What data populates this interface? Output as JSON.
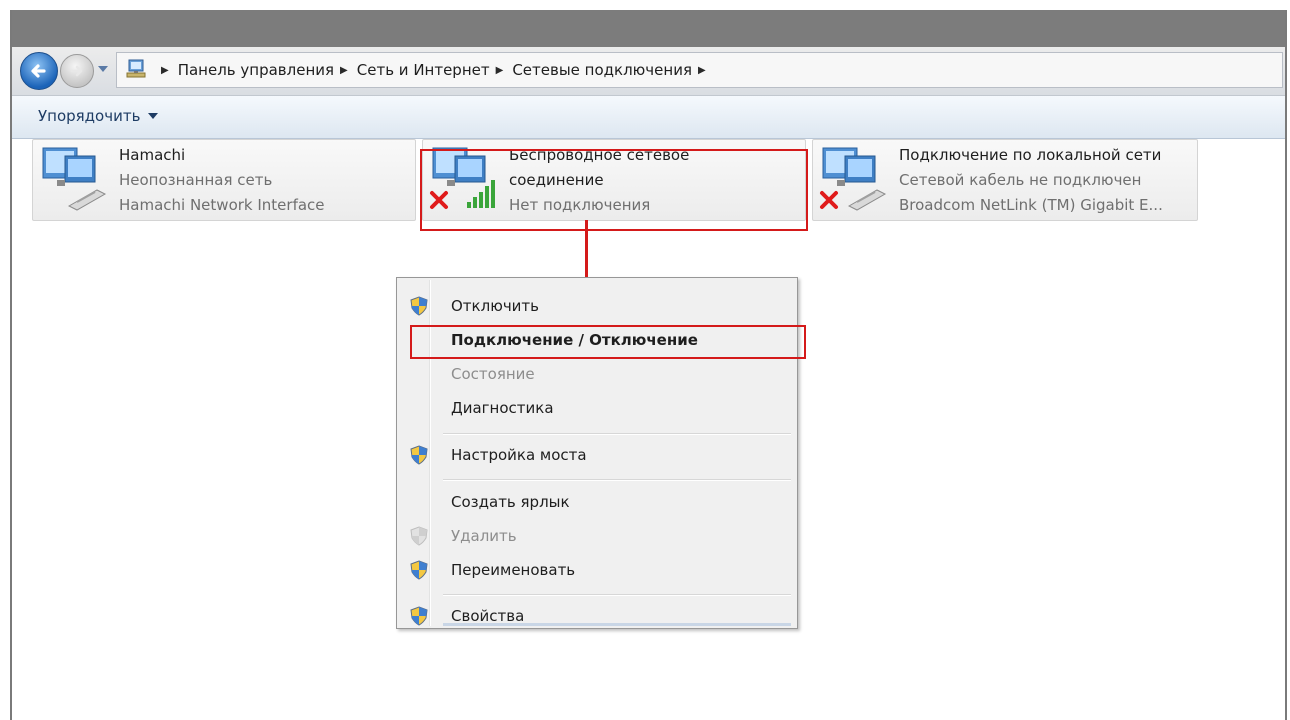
{
  "address": {
    "crumbs": [
      "Панель управления",
      "Сеть и Интернет",
      "Сетевые подключения"
    ]
  },
  "toolbar": {
    "organize_label": "Упорядочить"
  },
  "connections": [
    {
      "name": "Hamachi",
      "line2": "Неопознанная сеть",
      "line3": "Hamachi Network Interface",
      "status": "unidentified"
    },
    {
      "name": "Беспроводное сетевое",
      "name2": "соединение",
      "line3": "Нет подключения",
      "status": "disconnected"
    },
    {
      "name": "Подключение по локальной сети",
      "line2": "Сетевой кабель не подключен",
      "line3": "Broadcom NetLink (TM) Gigabit E...",
      "status": "cable-unplugged"
    }
  ],
  "context_menu": {
    "items": [
      {
        "label": "Отключить",
        "icon": "shield-icon",
        "enabled": true
      },
      {
        "label": "Подключение / Отключение",
        "bold": true,
        "enabled": true
      },
      {
        "label": "Состояние",
        "enabled": false
      },
      {
        "label": "Диагностика",
        "enabled": true
      },
      {
        "label": "Настройка моста",
        "icon": "shield-icon",
        "enabled": true
      },
      {
        "label": "Создать ярлык",
        "enabled": true
      },
      {
        "label": "Удалить",
        "icon": "shield-icon",
        "enabled": false
      },
      {
        "label": "Переименовать",
        "icon": "shield-icon",
        "enabled": true
      },
      {
        "label": "Свойства",
        "icon": "shield-icon",
        "enabled": true
      }
    ]
  },
  "colors": {
    "highlight": "#d41a1a",
    "accent": "#1b63b8"
  }
}
